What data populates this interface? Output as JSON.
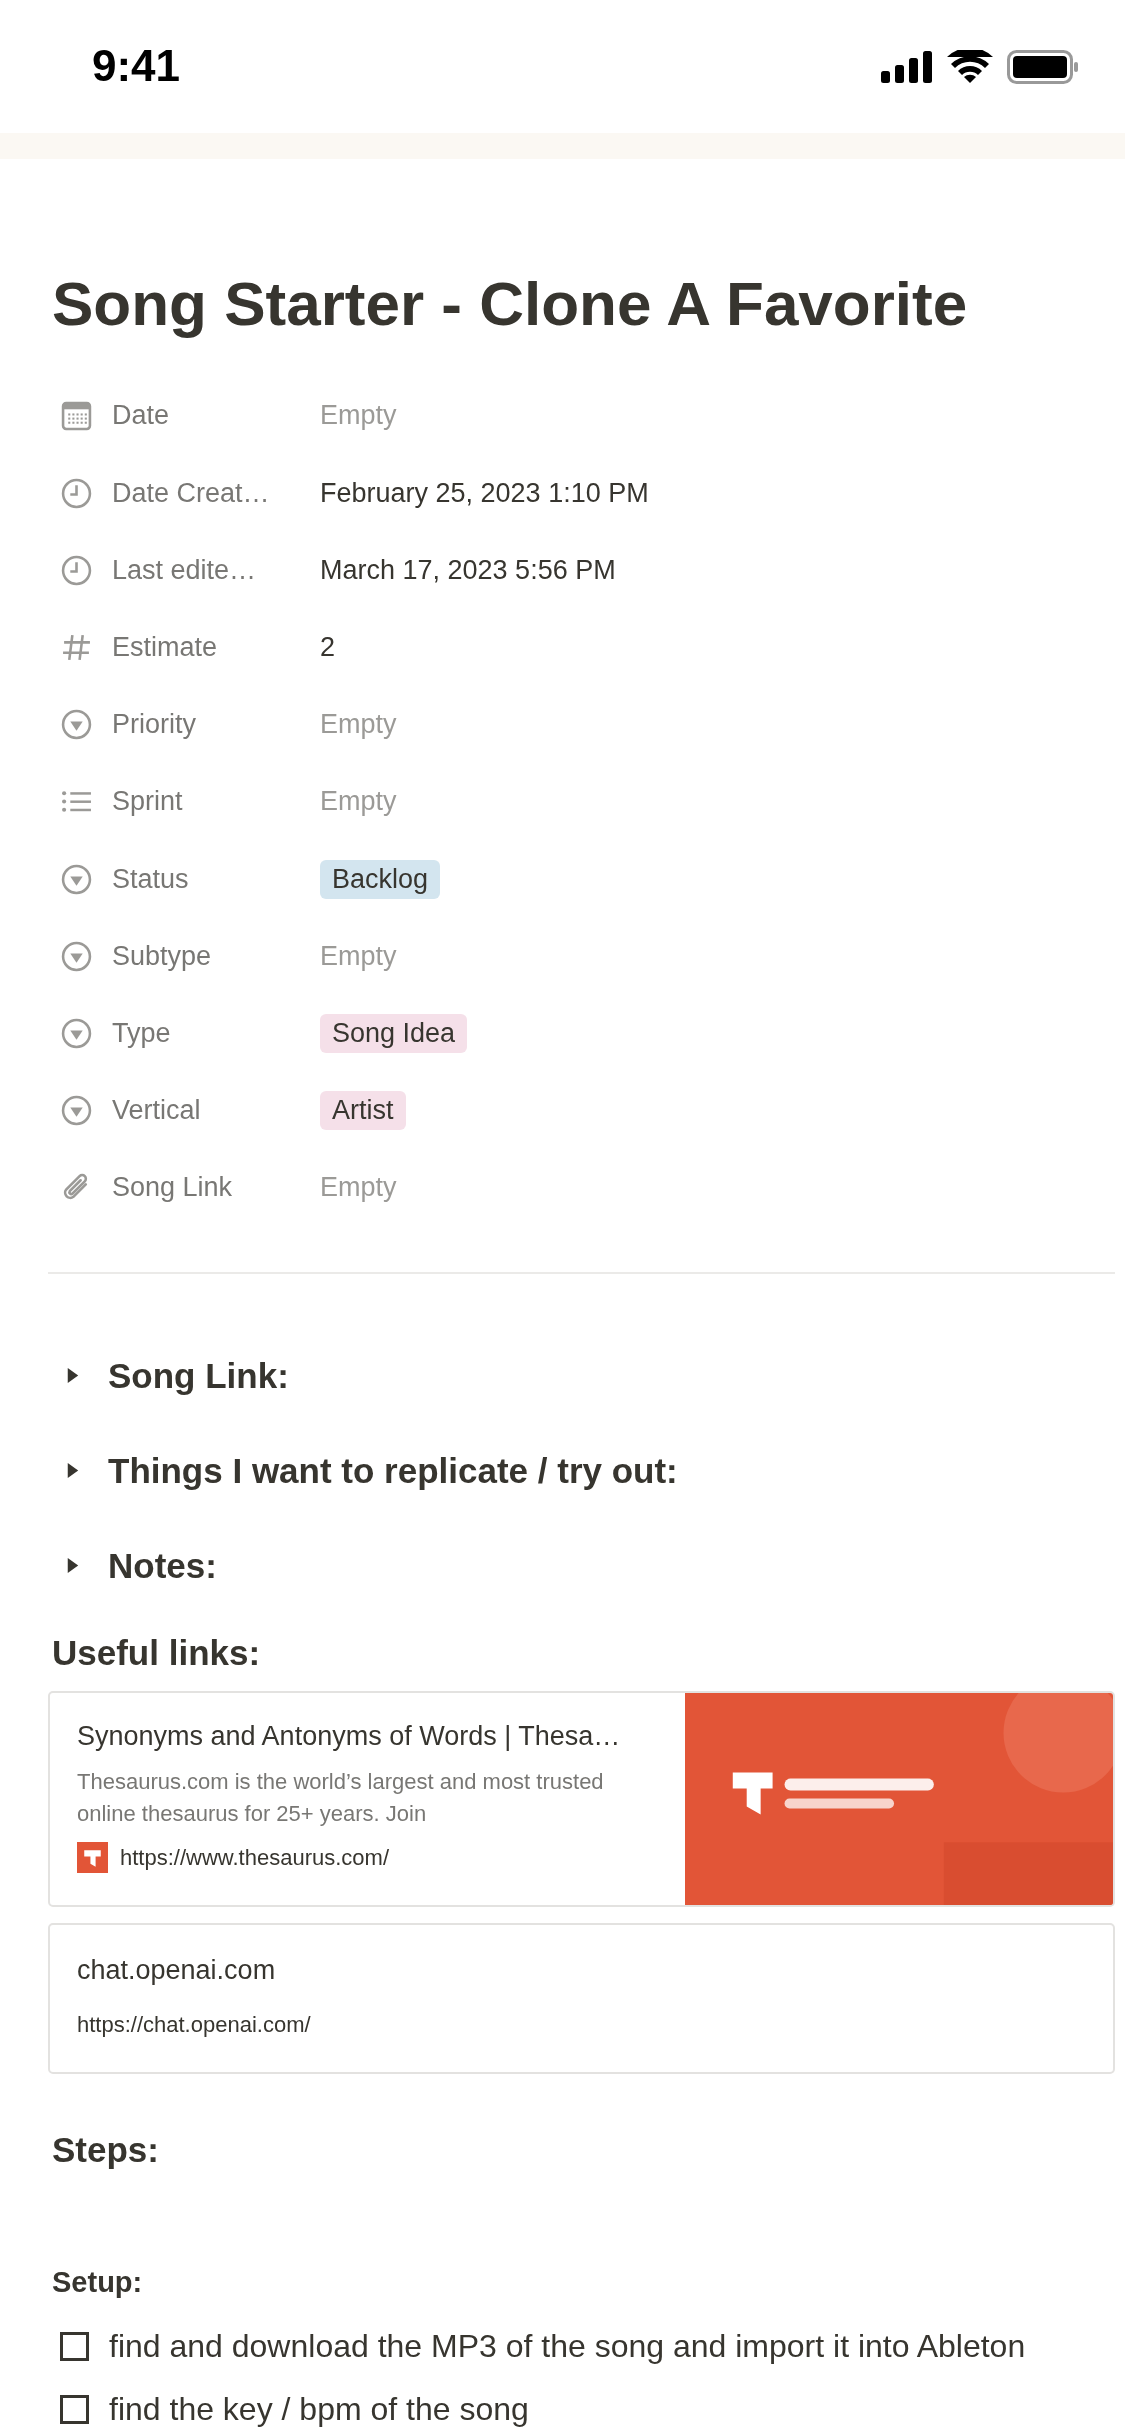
{
  "status_bar": {
    "time": "9:41"
  },
  "page": {
    "title": "Song Starter - Clone A Favorite"
  },
  "properties": [
    {
      "kind": "calendar",
      "label": "Date",
      "value": {
        "kind": "empty",
        "text": "Empty"
      }
    },
    {
      "kind": "clock",
      "label": "Date Creat…",
      "value": {
        "kind": "text",
        "text": "February 25, 2023 1:10 PM"
      }
    },
    {
      "kind": "clock",
      "label": "Last edite…",
      "value": {
        "kind": "text",
        "text": "March 17, 2023 5:56 PM"
      }
    },
    {
      "kind": "hash",
      "label": "Estimate",
      "value": {
        "kind": "text",
        "text": "2"
      }
    },
    {
      "kind": "select",
      "label": "Priority",
      "value": {
        "kind": "empty",
        "text": "Empty"
      }
    },
    {
      "kind": "list",
      "label": "Sprint",
      "value": {
        "kind": "empty",
        "text": "Empty"
      }
    },
    {
      "kind": "select",
      "label": "Status",
      "value": {
        "kind": "tag",
        "text": "Backlog",
        "color": "#d3e5ef"
      }
    },
    {
      "kind": "select",
      "label": "Subtype",
      "value": {
        "kind": "empty",
        "text": "Empty"
      }
    },
    {
      "kind": "select",
      "label": "Type",
      "value": {
        "kind": "tag",
        "text": "Song Idea",
        "color": "#f5e0e9"
      }
    },
    {
      "kind": "select",
      "label": "Vertical",
      "value": {
        "kind": "tag",
        "text": "Artist",
        "color": "#f5e0e9"
      }
    },
    {
      "kind": "paperclip",
      "label": "Song Link",
      "value": {
        "kind": "empty",
        "text": "Empty"
      }
    }
  ],
  "toggles": [
    {
      "title": "Song Link:",
      "expanded": false
    },
    {
      "title": "Things I want to replicate / try out:",
      "expanded": false
    },
    {
      "title": "Notes:",
      "expanded": false
    }
  ],
  "useful_links": {
    "heading": "Useful links:",
    "bookmarks": [
      {
        "title": "Synonyms and Antonyms of Words | Thesa…",
        "description": "Thesaurus.com is the world’s largest and most trusted online thesaurus for 25+ years. Join",
        "url": "https://www.thesaurus.com/",
        "kind": "preview"
      },
      {
        "title": "chat.openai.com",
        "url": "https://chat.openai.com/",
        "kind": "plain"
      }
    ]
  },
  "steps": {
    "heading": "Steps:",
    "subheading": "Setup:",
    "todos": [
      {
        "text": "find and download the MP3 of the song and import it into Ableton",
        "checked": false
      },
      {
        "text": "find the key / bpm of the song",
        "checked": false
      }
    ]
  }
}
